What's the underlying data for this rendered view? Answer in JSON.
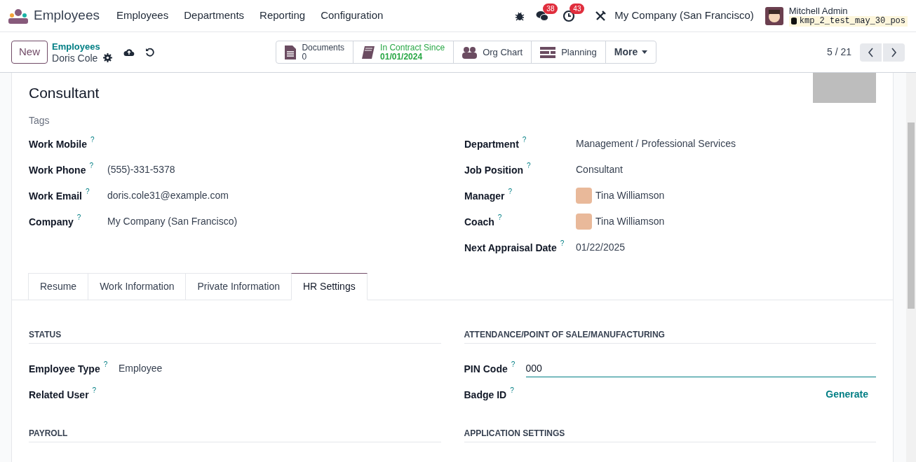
{
  "navbar": {
    "app_name": "Employees",
    "menu": [
      "Employees",
      "Departments",
      "Reporting",
      "Configuration"
    ],
    "messages_count": "38",
    "activities_count": "43",
    "company": "My Company (San Francisco)",
    "user_name": "Mitchell Admin",
    "database": "kmp_2_test_may_30_pos"
  },
  "control_panel": {
    "new_button": "New",
    "breadcrumb_parent": "Employees",
    "record_name": "Doris Cole",
    "pager": "5 / 21",
    "smart_buttons": [
      {
        "kind": "documents",
        "label": "Documents",
        "value": "0"
      },
      {
        "kind": "contract",
        "label": "In Contract Since",
        "value": "01/01/2024"
      },
      {
        "kind": "org",
        "label": "Org Chart"
      },
      {
        "kind": "planning",
        "label": "Planning"
      },
      {
        "kind": "more",
        "label": "More"
      }
    ]
  },
  "form": {
    "job_title": "Consultant",
    "tags_placeholder": "Tags",
    "left_fields": [
      {
        "label": "Work Mobile",
        "help": "?"
      },
      {
        "label": "Work Phone",
        "help": "?",
        "value": "(555)-331-5378"
      },
      {
        "label": "Work Email",
        "help": "?",
        "value": "doris.cole31@example.com"
      },
      {
        "label": "Company",
        "help": "?",
        "value": "My Company (San Francisco)"
      }
    ],
    "right_fields": [
      {
        "label": "Department",
        "help": "?",
        "value": "Management / Professional Services",
        "avatar": false
      },
      {
        "label": "Job Position",
        "help": "?",
        "value": "Consultant",
        "avatar": false
      },
      {
        "label": "Manager",
        "help": "?",
        "value": "Tina Williamson",
        "avatar": true
      },
      {
        "label": "Coach",
        "help": "?",
        "value": "Tina Williamson",
        "avatar": true
      },
      {
        "label": "Next Appraisal Date",
        "help": "?",
        "value": "01/22/2025",
        "avatar": false
      }
    ],
    "tabs": [
      {
        "label": "Resume",
        "selected": false
      },
      {
        "label": "Work Information",
        "selected": false
      },
      {
        "label": "Private Information",
        "selected": false
      },
      {
        "label": "HR Settings",
        "selected": true
      }
    ],
    "sections": [
      {
        "title": "STATUS",
        "fields": [
          {
            "kind": "text",
            "label": "Employee Type",
            "help": "?",
            "value": "Employee"
          },
          {
            "kind": "text",
            "label": "Related User",
            "help": "?"
          }
        ]
      },
      {
        "title": "ATTENDANCE/POINT OF SALE/MANUFACTURING",
        "fields": [
          {
            "kind": "input",
            "label": "PIN Code",
            "help": "?",
            "value": "000"
          },
          {
            "kind": "action",
            "label": "Badge ID",
            "help": "?",
            "action": "Generate"
          }
        ]
      },
      {
        "title": "PAYROLL"
      },
      {
        "title": "APPLICATION SETTINGS"
      }
    ]
  }
}
